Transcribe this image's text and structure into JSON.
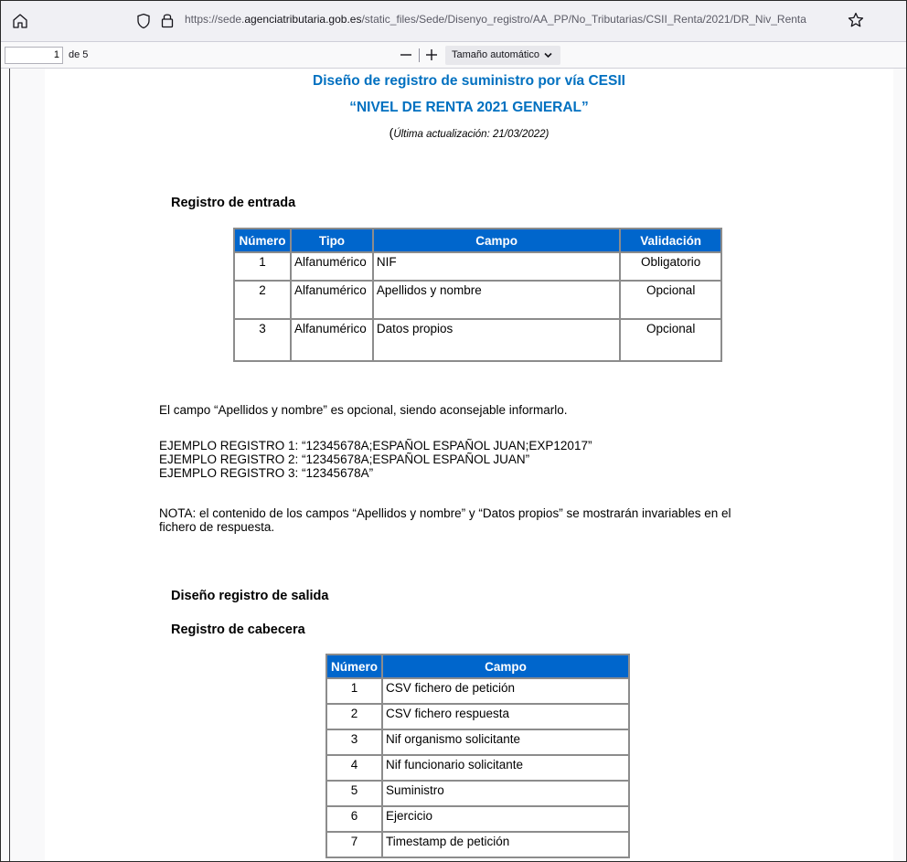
{
  "browser": {
    "url_prefix": "https://sede.",
    "url_domain": "agenciatributaria.gob.es",
    "url_path": "/static_files/Sede/Disenyo_registro/AA_PP/No_Tributarias/CSII_Renta/2021/DR_Niv_Renta",
    "icons": [
      "home-icon",
      "shield-icon",
      "lock-icon",
      "star-icon"
    ]
  },
  "pdf_toolbar": {
    "page_number": "1",
    "page_of": "de 5",
    "zoom_label": "Tamaño automático",
    "icons": [
      "zoom-out-icon",
      "zoom-in-icon",
      "chevron-down-icon"
    ]
  },
  "document": {
    "title": "Diseño de registro de suministro por vía CESII",
    "subtitle": "“NIVEL DE RENTA 2021 GENERAL”",
    "update_open": "(",
    "update_text": "Última actualización: 21/03/2022)",
    "entrada_heading": "Registro de entrada",
    "entrada_table": {
      "headers": [
        "Número",
        "Tipo",
        "Campo",
        "Validación"
      ],
      "rows": [
        [
          "1",
          "Alfanumérico",
          "NIF",
          "Obligatorio"
        ],
        [
          "2",
          "Alfanumérico",
          "Apellidos y nombre",
          "Opcional"
        ],
        [
          "3",
          "Alfanumérico",
          "Datos propios",
          "Opcional"
        ]
      ]
    },
    "campo_note": "El campo “Apellidos y nombre” es opcional, siendo aconsejable informarlo.",
    "ejemplos": [
      "EJEMPLO REGISTRO 1: “12345678A;ESPAÑOL ESPAÑOL JUAN;EXP12017”",
      "EJEMPLO REGISTRO 2: “12345678A;ESPAÑOL ESPAÑOL JUAN”",
      "EJEMPLO REGISTRO 3: “12345678A”"
    ],
    "nota_line1": "NOTA: el contenido de los campos “Apellidos y nombre” y “Datos propios” se mostrarán invariables en el",
    "nota_line2": "fichero de respuesta.",
    "salida_heading": "Diseño registro de salida",
    "cabecera_heading": "Registro de cabecera",
    "cabecera_table": {
      "headers": [
        "Número",
        "Campo"
      ],
      "rows": [
        [
          "1",
          "CSV fichero de petición"
        ],
        [
          "2",
          "CSV fichero respuesta"
        ],
        [
          "3",
          "Nif organismo solicitante"
        ],
        [
          "4",
          "Nif funcionario solicitante"
        ],
        [
          "5",
          "Suministro"
        ],
        [
          "6",
          "Ejercicio"
        ],
        [
          "7",
          "Timestamp de petición"
        ]
      ]
    }
  },
  "colors": {
    "title_blue": "#0070c0",
    "header_blue": "#0066cc",
    "table_border": "#8c8c8c"
  }
}
